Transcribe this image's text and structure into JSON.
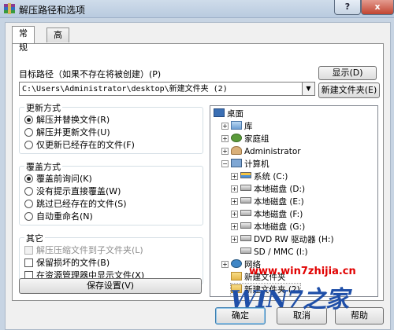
{
  "window": {
    "title": "解压路径和选项",
    "help_label": "?",
    "close_label": "x"
  },
  "tabs": [
    {
      "label": "常规"
    },
    {
      "label": "高级"
    }
  ],
  "target": {
    "label": "目标路径（如果不存在将被创建）(P)",
    "value": "C:\\Users\\Administrator\\desktop\\新建文件夹 (2)",
    "show_button": "显示(D)",
    "new_folder_button": "新建文件夹(E)"
  },
  "update_mode": {
    "title": "更新方式",
    "options": [
      {
        "label": "解压并替换文件(R)",
        "selected": true
      },
      {
        "label": "解压并更新文件(U)",
        "selected": false
      },
      {
        "label": "仅更新已经存在的文件(F)",
        "selected": false
      }
    ]
  },
  "overwrite_mode": {
    "title": "覆盖方式",
    "options": [
      {
        "label": "覆盖前询问(K)",
        "selected": true
      },
      {
        "label": "没有提示直接覆盖(W)",
        "selected": false
      },
      {
        "label": "跳过已经存在的文件(S)",
        "selected": false
      },
      {
        "label": "自动重命名(N)",
        "selected": false
      }
    ]
  },
  "misc": {
    "title": "其它",
    "options": [
      {
        "label": "解压压缩文件到子文件夹(L)",
        "checked": false,
        "disabled": true
      },
      {
        "label": "保留损坏的文件(B)",
        "checked": false,
        "disabled": false
      },
      {
        "label": "在资源管理器中显示文件(X)",
        "checked": false,
        "disabled": false
      }
    ]
  },
  "save_settings_button": "保存设置(V)",
  "tree": [
    {
      "label": "桌面",
      "icon": "desktop-icon",
      "expander": ""
    },
    {
      "label": "库",
      "icon": "library-icon",
      "expander": "+"
    },
    {
      "label": "家庭组",
      "icon": "homegroup-icon",
      "expander": "+"
    },
    {
      "label": "Administrator",
      "icon": "user-icon",
      "expander": "+"
    },
    {
      "label": "计算机",
      "icon": "computer-icon",
      "expander": "−"
    },
    {
      "label": "系统 (C:)",
      "icon": "system-drive-icon",
      "expander": "+"
    },
    {
      "label": "本地磁盘 (D:)",
      "icon": "drive-icon",
      "expander": "+"
    },
    {
      "label": "本地磁盘 (E:)",
      "icon": "drive-icon",
      "expander": "+"
    },
    {
      "label": "本地磁盘 (F:)",
      "icon": "drive-icon",
      "expander": "+"
    },
    {
      "label": "本地磁盘 (G:)",
      "icon": "drive-icon",
      "expander": "+"
    },
    {
      "label": "DVD RW 驱动器 (H:)",
      "icon": "dvd-drive-icon",
      "expander": "+"
    },
    {
      "label": "SD / MMC (I:)",
      "icon": "sd-card-icon",
      "expander": ""
    },
    {
      "label": "网络",
      "icon": "network-icon",
      "expander": "+"
    },
    {
      "label": "新建文件夹",
      "icon": "folder-icon",
      "expander": ""
    },
    {
      "label": "新建文件夹 (2)",
      "icon": "folder-icon",
      "expander": ""
    }
  ],
  "footer": {
    "ok_button": "确定",
    "cancel_button": "取消",
    "help_button": "帮助"
  },
  "watermark": {
    "url": "www.win7zhijia.cn",
    "logo_text": "WIN7之家"
  },
  "colors": {
    "titlebar": "#c7d4e3",
    "close_button": "#c14532",
    "watermark_url": "#e10000",
    "watermark_logo": "#1f4fa8"
  }
}
